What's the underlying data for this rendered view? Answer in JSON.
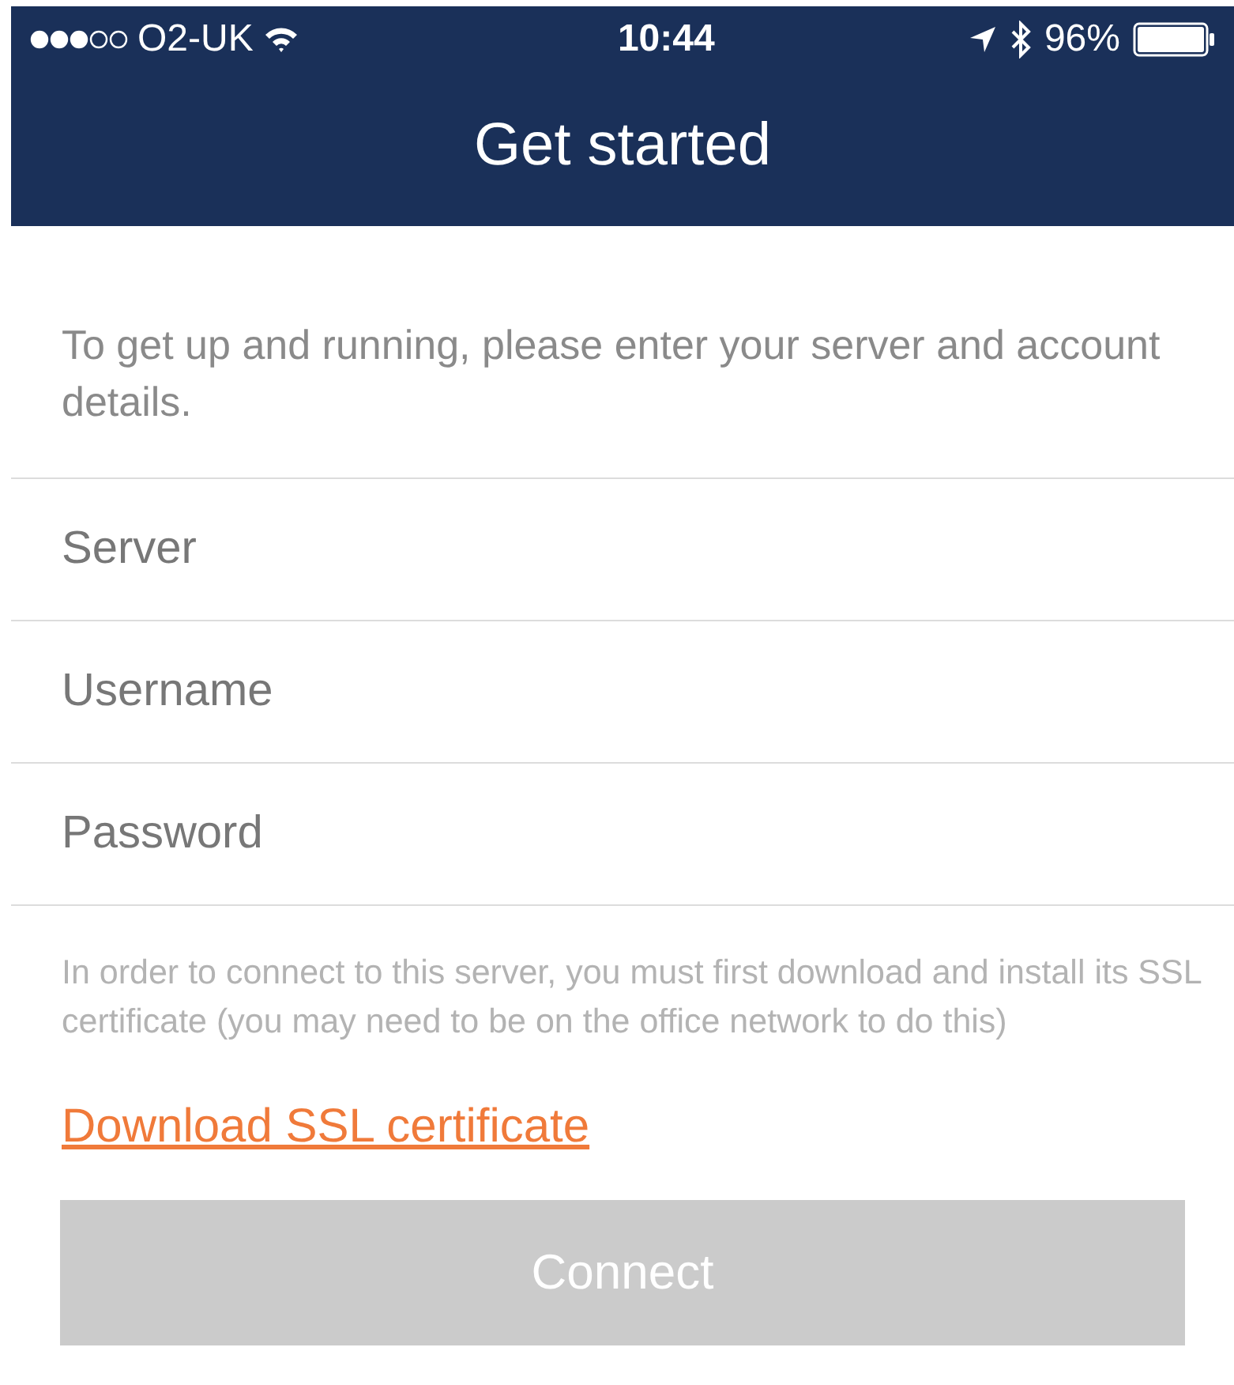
{
  "status_bar": {
    "carrier": "O2-UK",
    "time": "10:44",
    "battery": "96%"
  },
  "header": {
    "title": "Get started"
  },
  "intro": "To get up and running, please enter your server and account details.",
  "fields": [
    {
      "placeholder": "Server"
    },
    {
      "placeholder": "Username"
    },
    {
      "placeholder": "Password"
    }
  ],
  "note": "In order to connect to this server, you must first download and install its SSL certificate (you may need to be on the office network to do this)",
  "link": "Download SSL certificate",
  "connect_button": {
    "label": "Connect",
    "disabled": true
  }
}
